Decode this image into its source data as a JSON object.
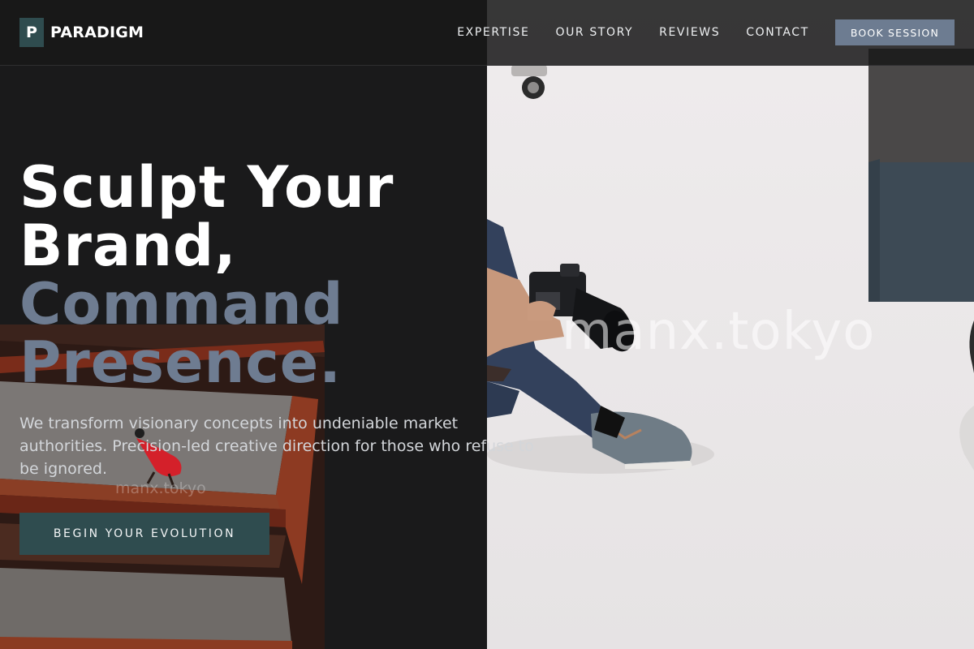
{
  "brand": {
    "logo_letter": "P",
    "name": "PARADIGM"
  },
  "nav": {
    "items": [
      {
        "label": "EXPERTISE"
      },
      {
        "label": "OUR STORY"
      },
      {
        "label": "REVIEWS"
      },
      {
        "label": "CONTACT"
      }
    ],
    "cta_label": "BOOK SESSION"
  },
  "hero": {
    "title_line_1": "Sculpt Your",
    "title_line_2": "Brand,",
    "title_line_3": "Command",
    "title_line_4": "Presence.",
    "subtitle_line_1": "We transform visionary concepts into undeniable market",
    "subtitle_line_2": "authorities. Precision-led creative direction for those who refuse to",
    "subtitle_line_3": "be ignored.",
    "cta_label": "BEGIN YOUR EVOLUTION"
  },
  "images": {
    "right_watermark": "manx.tokyo",
    "left_watermark": "manx.tokyo"
  },
  "colors": {
    "background": "#1a1a1b",
    "accent_teal": "#2f4c4f",
    "accent_slate": "#6e7c91",
    "text_white": "#ffffff"
  }
}
